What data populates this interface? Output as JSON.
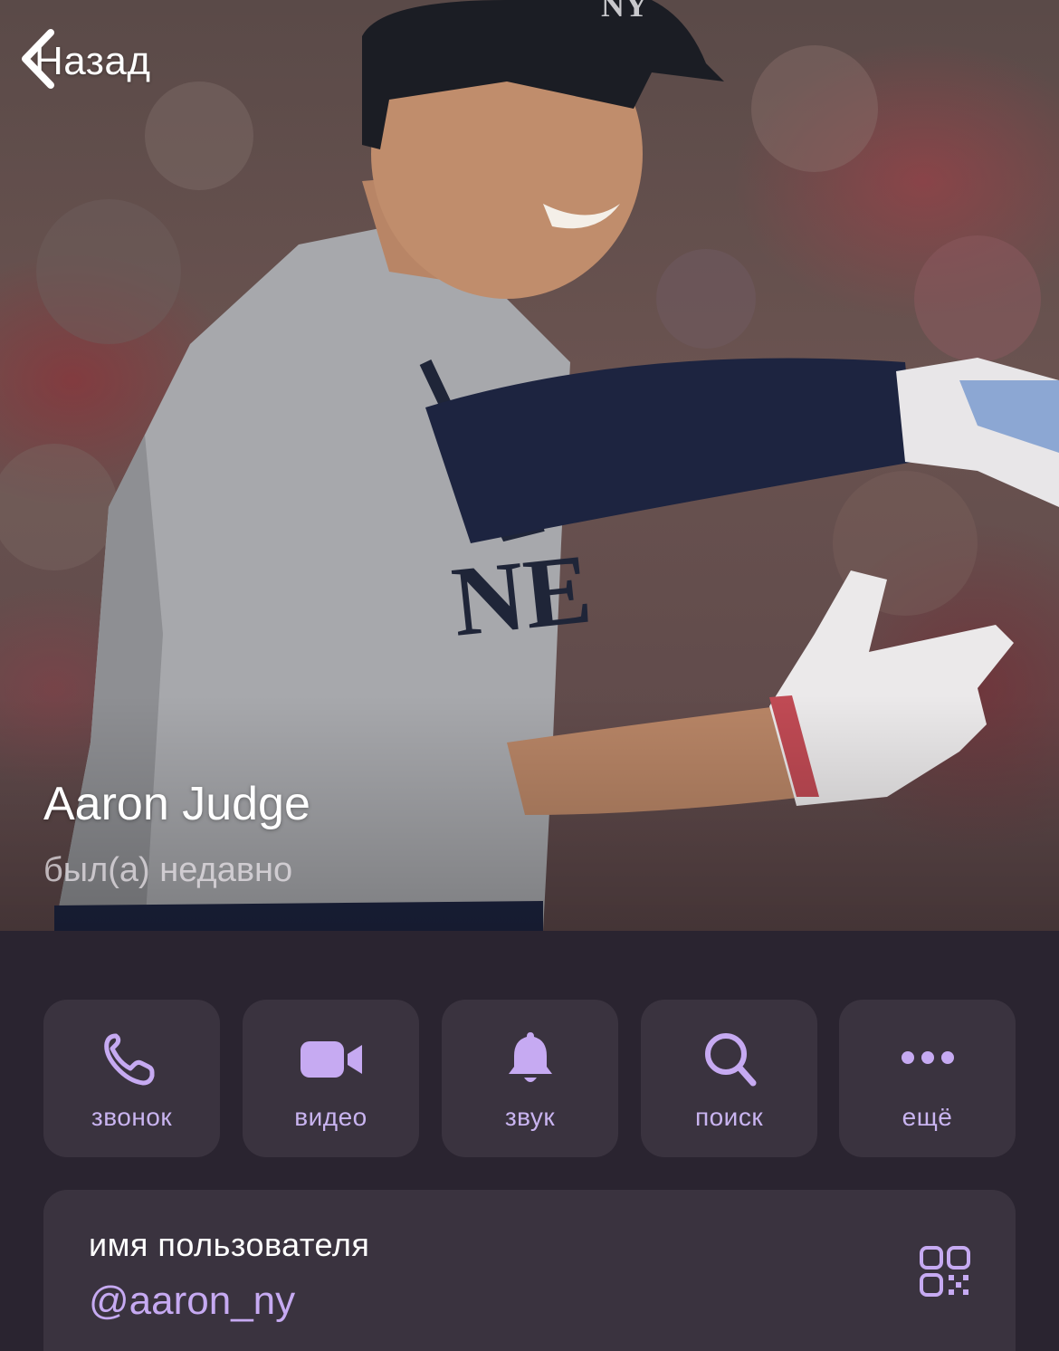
{
  "header": {
    "back_label": "Назад"
  },
  "profile": {
    "name": "Aaron Judge",
    "status": "был(а) недавно"
  },
  "actions": [
    {
      "icon": "phone-icon",
      "label": "звонок"
    },
    {
      "icon": "video-camera-icon",
      "label": "видео"
    },
    {
      "icon": "bell-icon",
      "label": "звук"
    },
    {
      "icon": "search-icon",
      "label": "поиск"
    },
    {
      "icon": "more-icon",
      "label": "ещё"
    }
  ],
  "info": {
    "username_label": "имя пользователя",
    "username_value": "@aaron_ny",
    "qr_icon": "qr-code-icon"
  },
  "colors": {
    "background": "#2a2430",
    "card": "#3a333f",
    "accent": "#c6aaf2"
  }
}
